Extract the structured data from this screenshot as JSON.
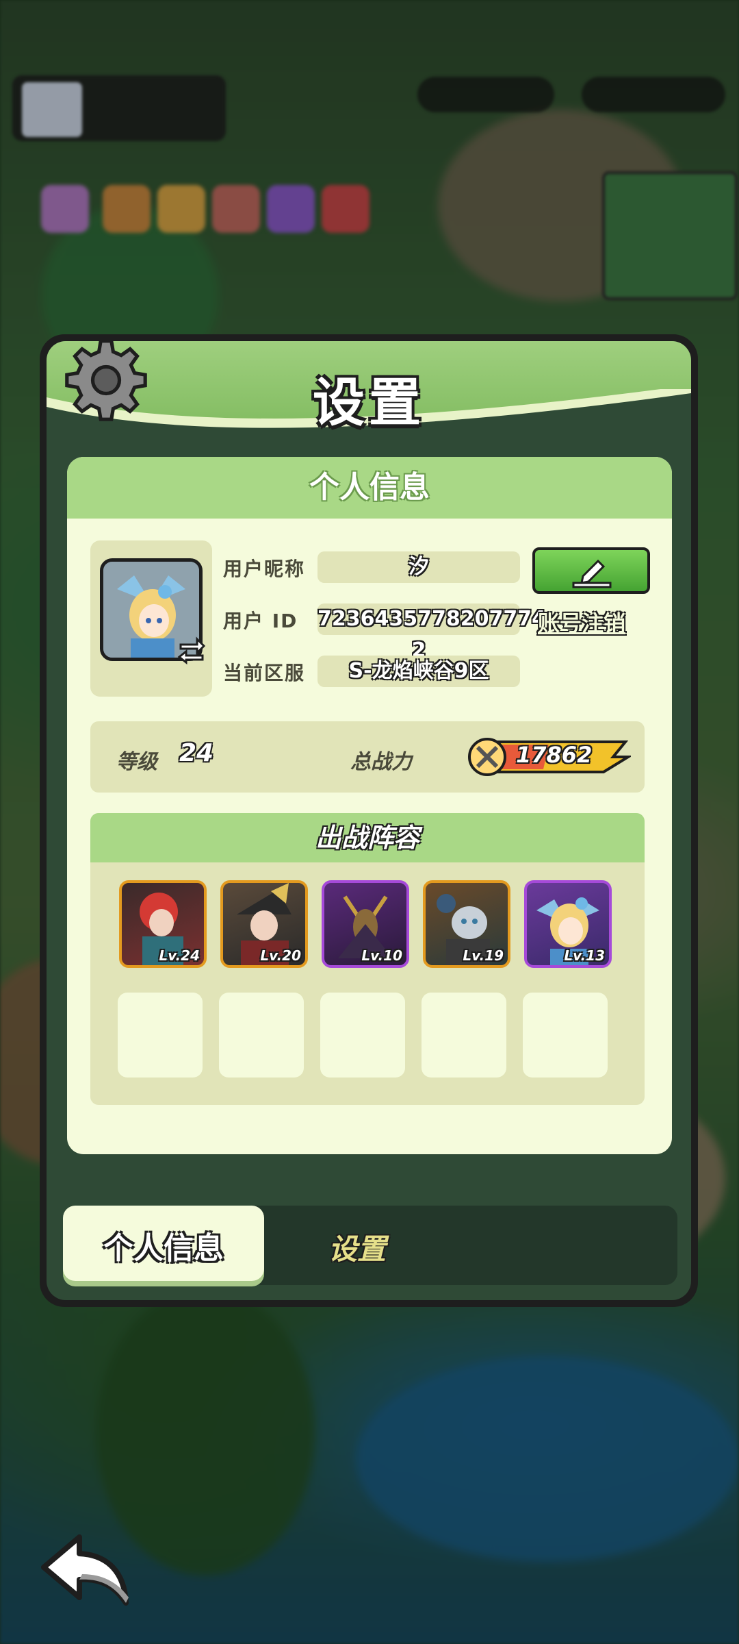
{
  "dialog": {
    "title": "设置"
  },
  "profile": {
    "section_title": "个人信息",
    "nickname_label": "用户昵称",
    "nickname": "汐",
    "id_label": "用户 ID",
    "user_id": "7236435778207774​2",
    "server_label": "当前区服",
    "server": "S-龙焰峡谷9区",
    "cancel_account_label": "账号注销"
  },
  "stats": {
    "level_label": "等级",
    "level": "24",
    "power_label": "总战力",
    "power": "17862"
  },
  "lineup": {
    "title": "出战阵容",
    "heroes": [
      {
        "level": "Lv.24",
        "rarity": "orange"
      },
      {
        "level": "Lv.20",
        "rarity": "orange"
      },
      {
        "level": "Lv.10",
        "rarity": "purple"
      },
      {
        "level": "Lv.19",
        "rarity": "orange"
      },
      {
        "level": "Lv.13",
        "rarity": "purple"
      }
    ]
  },
  "tabs": {
    "active": "个人信息",
    "settings": "设置"
  },
  "icons": {
    "gear": "gear-icon",
    "edit": "pencil-icon",
    "swap": "swap-arrows-icon",
    "power": "crossed-swords-icon",
    "back": "back-arrow-icon"
  }
}
